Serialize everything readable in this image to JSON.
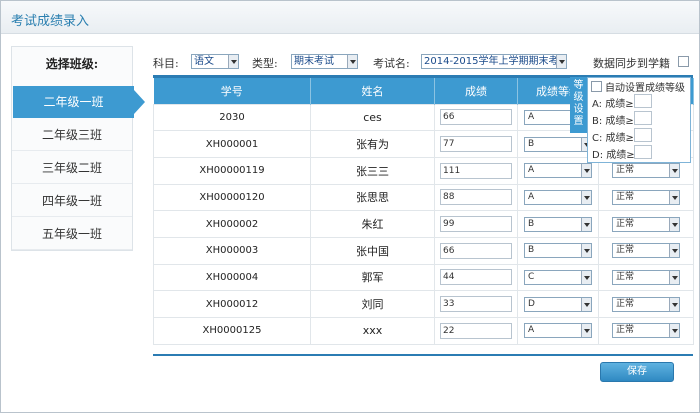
{
  "app": {
    "title": "考试成绩录入"
  },
  "sidebar": {
    "title": "选择班级:",
    "items": [
      {
        "label": "二年级一班",
        "active": true
      },
      {
        "label": "二年级三班"
      },
      {
        "label": "三年级二班"
      },
      {
        "label": "四年级一班"
      },
      {
        "label": "五年级一班"
      }
    ]
  },
  "filters": {
    "subject_label": "科目:",
    "subject_value": "语文",
    "type_label": "类型:",
    "type_value": "期末考试",
    "exam_label": "考试名:",
    "exam_value": "2014-2015学年上学期期末考试",
    "sync_label": "数据同步到学籍"
  },
  "table": {
    "headers": [
      "学号",
      "姓名",
      "成绩",
      "成绩等级",
      ""
    ],
    "rows": [
      {
        "id": "2030",
        "name": "ces",
        "score": "66",
        "grade": "A",
        "status": ""
      },
      {
        "id": "XH000001",
        "name": "张有为",
        "score": "77",
        "grade": "B",
        "status": ""
      },
      {
        "id": "XH00000119",
        "name": "张三三",
        "score": "111",
        "grade": "A",
        "status": "正常"
      },
      {
        "id": "XH00000120",
        "name": "张思思",
        "score": "88",
        "grade": "A",
        "status": "正常"
      },
      {
        "id": "XH000002",
        "name": "朱红",
        "score": "99",
        "grade": "B",
        "status": "正常"
      },
      {
        "id": "XH000003",
        "name": "张中国",
        "score": "66",
        "grade": "B",
        "status": "正常"
      },
      {
        "id": "XH000004",
        "name": "郭军",
        "score": "44",
        "grade": "C",
        "status": "正常"
      },
      {
        "id": "XH000012",
        "name": "刘同",
        "score": "33",
        "grade": "D",
        "status": "正常"
      },
      {
        "id": "XH0000125",
        "name": "xxx",
        "score": "22",
        "grade": "A",
        "status": "正常"
      }
    ]
  },
  "grade_panel": {
    "tab_label": "等级设置",
    "auto_label": "自动设置成绩等级",
    "rows": [
      {
        "label": "A: 成绩≥"
      },
      {
        "label": "B: 成绩≥"
      },
      {
        "label": "C: 成绩≥"
      },
      {
        "label": "D: 成绩≥"
      }
    ]
  },
  "actions": {
    "save_label": "保存"
  },
  "colors": {
    "accent": "#3d9ad1",
    "dark_accent": "#2b7cb3"
  }
}
